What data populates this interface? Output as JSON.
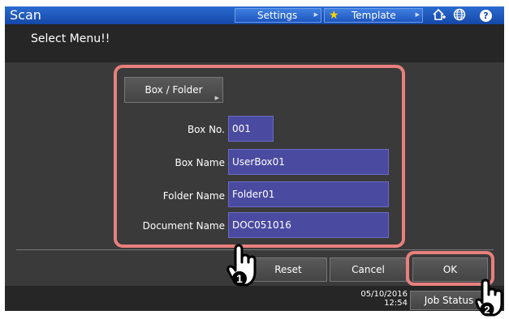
{
  "header": {
    "title": "Scan",
    "settings_label": "Settings",
    "template_label": "Template",
    "help_label": "?"
  },
  "message": "Select Menu!!",
  "box_folder_button": "Box / Folder",
  "fields": {
    "box_no": {
      "label": "Box No.",
      "value": "001"
    },
    "box_name": {
      "label": "Box Name",
      "value": "UserBox01"
    },
    "folder_name": {
      "label": "Folder Name",
      "value": "Folder01"
    },
    "document_name": {
      "label": "Document Name",
      "value": "DOC051016"
    }
  },
  "buttons": {
    "reset": "Reset",
    "cancel": "Cancel",
    "ok": "OK"
  },
  "status": {
    "date": "05/10/2016",
    "time": "12:54",
    "job_status": "Job Status"
  },
  "callouts": {
    "step1": "1",
    "step2": "2"
  },
  "icons": {
    "home": "home-add-icon",
    "globe": "globe-icon",
    "help": "help-icon",
    "star": "star-icon"
  },
  "colors": {
    "header_blue": "#1e55bf",
    "highlight": "#e8807e",
    "field_bg": "#4a4aa0",
    "star": "#ffd200"
  }
}
